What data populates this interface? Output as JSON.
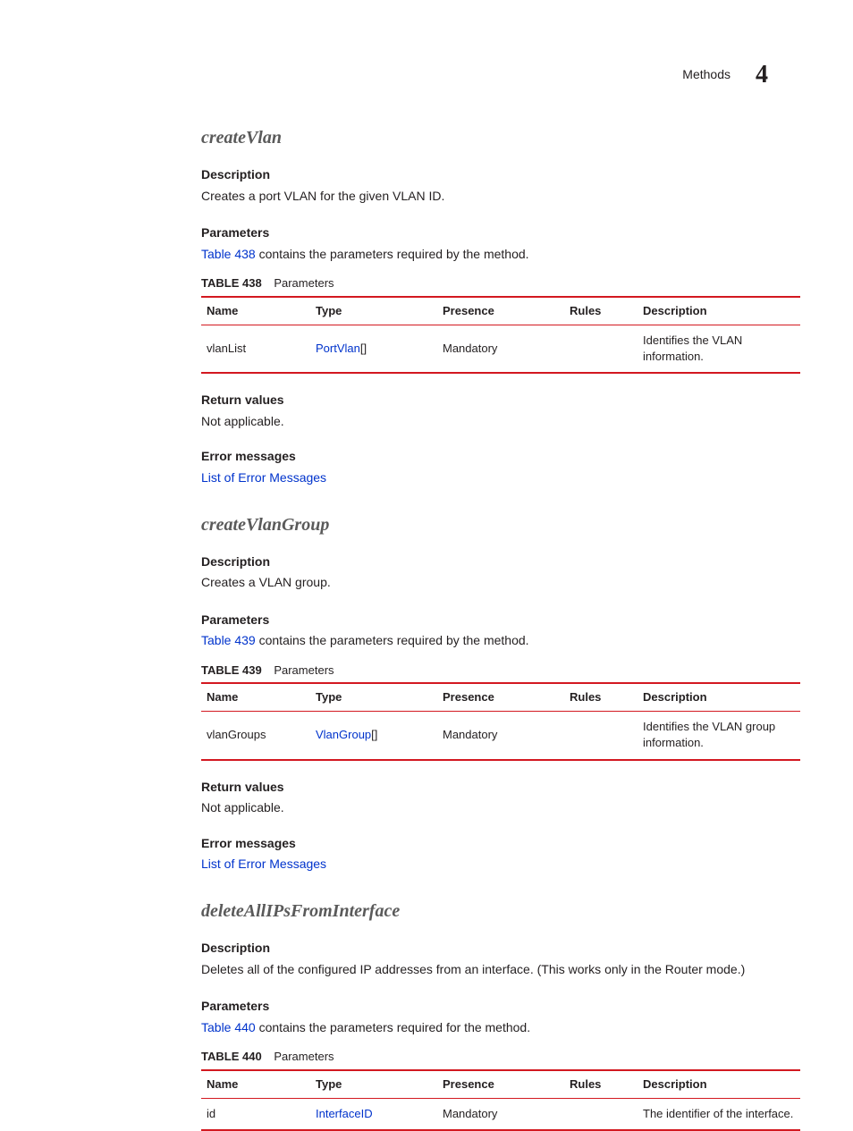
{
  "header": {
    "section": "Methods",
    "chapter_number": "4"
  },
  "columns": {
    "name": "Name",
    "type": "Type",
    "presence": "Presence",
    "rules": "Rules",
    "description": "Description"
  },
  "labels": {
    "description": "Description",
    "parameters": "Parameters",
    "return_values": "Return values",
    "error_messages": "Error messages",
    "table_prefix": "TABLE",
    "table_title": "Parameters",
    "error_link_text": "List of Error Messages"
  },
  "methods": [
    {
      "title": "createVlan",
      "description": "Creates a port VLAN for the given VLAN ID.",
      "param_intro_link": "Table 438",
      "param_intro_rest": " contains the parameters required by the method.",
      "table_number": "438",
      "rows": [
        {
          "name": "vlanList",
          "type_link": "PortVlan",
          "type_suffix": "[]",
          "presence": "Mandatory",
          "rules": "",
          "description": "Identifies the VLAN information."
        }
      ],
      "return_text": "Not applicable."
    },
    {
      "title": "createVlanGroup",
      "description": "Creates a VLAN group.",
      "param_intro_link": "Table 439",
      "param_intro_rest": " contains the parameters required by the method.",
      "table_number": "439",
      "rows": [
        {
          "name": "vlanGroups",
          "type_link": "VlanGroup",
          "type_suffix": "[]",
          "presence": "Mandatory",
          "rules": "",
          "description": "Identifies the VLAN group information."
        }
      ],
      "return_text": "Not applicable."
    },
    {
      "title": "deleteAllIPsFromInterface",
      "description": "Deletes all of the configured IP addresses from an interface. (This works only in the Router mode.)",
      "param_intro_link": "Table 440",
      "param_intro_rest": " contains the parameters required for the method.",
      "table_number": "440",
      "rows": [
        {
          "name": "id",
          "type_link": "InterfaceID",
          "type_suffix": "",
          "presence": "Mandatory",
          "rules": "",
          "description": "The identifier of the interface."
        }
      ],
      "return_text": ""
    }
  ]
}
